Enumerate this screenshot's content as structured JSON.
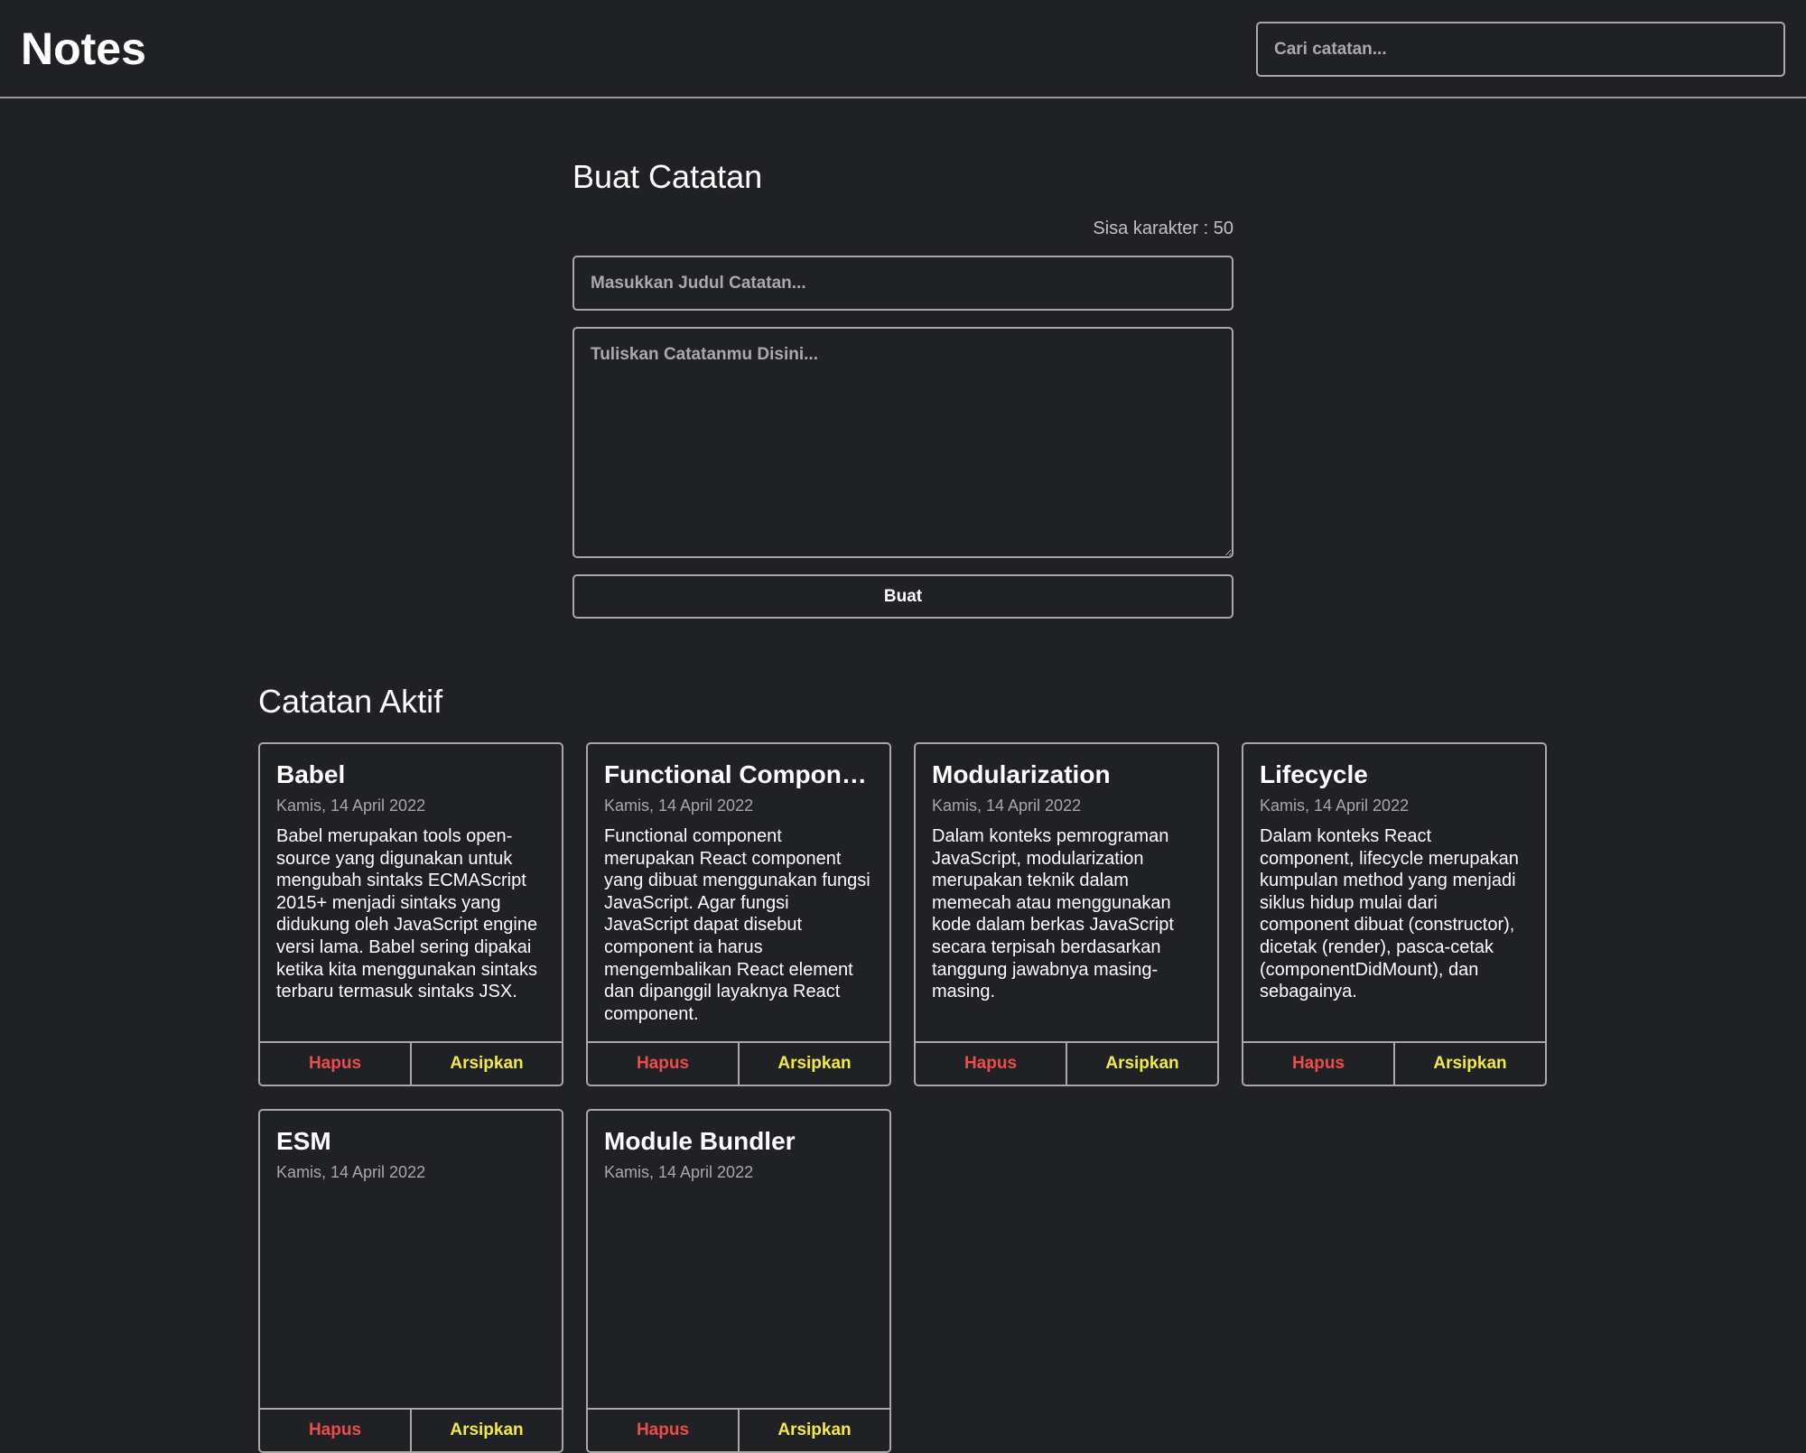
{
  "header": {
    "title": "Notes",
    "search_placeholder": "Cari catatan..."
  },
  "form": {
    "title": "Buat Catatan",
    "char_counter": "Sisa karakter : 50",
    "title_placeholder": "Masukkan Judul Catatan...",
    "body_placeholder": "Tuliskan Catatanmu Disini...",
    "submit_label": "Buat"
  },
  "active_notes": {
    "heading": "Catatan Aktif",
    "delete_label": "Hapus",
    "archive_label": "Arsipkan",
    "notes": [
      {
        "title": "Babel",
        "date": "Kamis, 14 April 2022",
        "body": "Babel merupakan tools open-source yang digunakan untuk mengubah sintaks ECMAScript 2015+ menjadi sintaks yang didukung oleh JavaScript engine versi lama. Babel sering dipakai ketika kita menggunakan sintaks terbaru termasuk sintaks JSX."
      },
      {
        "title": "Functional Component",
        "date": "Kamis, 14 April 2022",
        "body": "Functional component merupakan React component yang dibuat menggunakan fungsi JavaScript. Agar fungsi JavaScript dapat disebut component ia harus mengembalikan React element dan dipanggil layaknya React component."
      },
      {
        "title": "Modularization",
        "date": "Kamis, 14 April 2022",
        "body": "Dalam konteks pemrograman JavaScript, modularization merupakan teknik dalam memecah atau menggunakan kode dalam berkas JavaScript secara terpisah berdasarkan tanggung jawabnya masing-masing."
      },
      {
        "title": "Lifecycle",
        "date": "Kamis, 14 April 2022",
        "body": "Dalam konteks React component, lifecycle merupakan kumpulan method yang menjadi siklus hidup mulai dari component dibuat (constructor), dicetak (render), pasca-cetak (componentDidMount), dan sebagainya."
      },
      {
        "title": "ESM",
        "date": "Kamis, 14 April 2022",
        "body": ""
      },
      {
        "title": "Module Bundler",
        "date": "Kamis, 14 April 2022",
        "body": ""
      }
    ]
  },
  "colors": {
    "background": "#202125",
    "border": "#a8a8a8",
    "delete": "#ef4b4b",
    "archive": "#f2ea3f"
  }
}
